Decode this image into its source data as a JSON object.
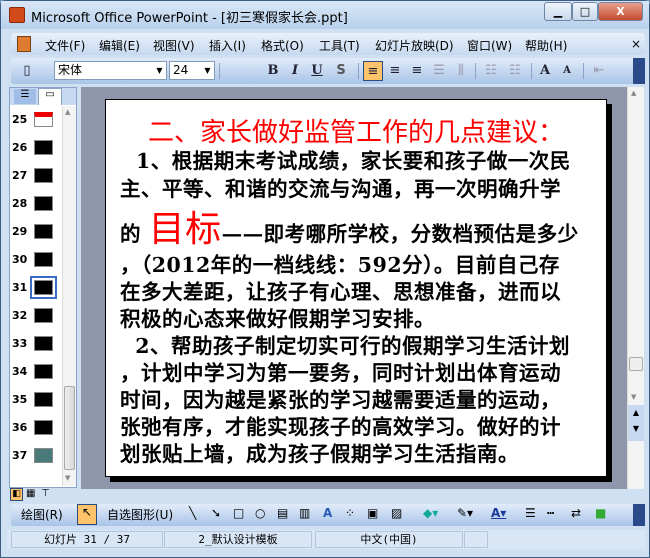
{
  "window": {
    "title": "Microsoft Office PowerPoint - [初三寒假家长会.ppt]",
    "minimize": "▁",
    "maximize": "□",
    "close": "X"
  },
  "menu": [
    "文件(F)",
    "编辑(E)",
    "视图(V)",
    "插入(I)",
    "格式(O)",
    "工具(T)",
    "幻灯片放映(D)",
    "窗口(W)",
    "帮助(H)"
  ],
  "menu_close": "×",
  "toolbar": {
    "font": "宋体",
    "size": "24",
    "bold": "B",
    "italic": "I",
    "underline": "U",
    "shadow": "S",
    "grow": "A",
    "shrink": "A"
  },
  "thumbnails": [
    "25",
    "26",
    "27",
    "28",
    "29",
    "30",
    "31",
    "32",
    "33",
    "34",
    "35",
    "36",
    "37"
  ],
  "selected_slide": "31",
  "slide": {
    "title": "二、家长做好监管工作的几点建议：",
    "lines": [
      "1、根据期末考试成绩，家长要和孩子做一次民",
      "主、平等、和谐的交流与沟通，再一次明确升学"
    ],
    "line3_pre": "的 ",
    "line3_big": "目标",
    "line3_post": "——即考哪所学校，分数档预估是多少",
    "lines2": [
      "，（2012年的一档线线：592分）。目前自己存",
      "在多大差距，让孩子有心理、思想准备，进而以",
      "积极的心态来做好假期学习安排。",
      "  2、帮助孩子制定切实可行的假期学习生活计划",
      "，计划中学习为第一要务，同时计划出体育运动",
      "时间，因为越是紧张的学习越需要适量的运动，",
      "张弛有序，才能实现孩子的高效学习。做好的计",
      "划张贴上墙，成为孩子假期学习生活指南。"
    ]
  },
  "drawbar": {
    "draw": "绘图(R)",
    "autoshapes": "自选图形(U)"
  },
  "status": {
    "slide": "幻灯片 31 / 37",
    "template": "2_默认设计模板",
    "language": "中文(中国)"
  }
}
